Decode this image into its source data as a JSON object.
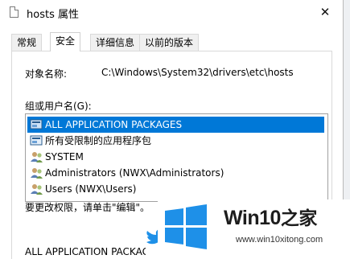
{
  "window": {
    "title": "hosts 属性",
    "close_glyph": "✕"
  },
  "tabs": [
    {
      "label": "常规",
      "active": false
    },
    {
      "label": "安全",
      "active": true
    },
    {
      "label": "详细信息",
      "active": false
    },
    {
      "label": "以前的版本",
      "active": false
    }
  ],
  "security": {
    "object_name_label": "对象名称:",
    "object_name_value": "C:\\Windows\\System32\\drivers\\etc\\hosts",
    "group_label": "组或用户名(G):",
    "principals": [
      {
        "label": "ALL APPLICATION PACKAGES",
        "icon": "package-group-icon",
        "selected": true
      },
      {
        "label": "所有受限制的应用程序包",
        "icon": "package-group-icon",
        "selected": false
      },
      {
        "label": "SYSTEM",
        "icon": "users-group-icon",
        "selected": false
      },
      {
        "label": "Administrators (NWX\\Administrators)",
        "icon": "users-group-icon",
        "selected": false
      },
      {
        "label": "Users (NWX\\Users)",
        "icon": "users-group-icon",
        "selected": false
      }
    ],
    "change_hint": "要更改权限，请单击\"编辑\"。",
    "permissions_header": "ALL APPLICATION PACKAGES"
  },
  "watermark": {
    "brand": "Win10",
    "brand_suffix": "之家",
    "site": "www.win10xitong.com"
  },
  "colors": {
    "selection": "#0078d7",
    "windows_logo": "#1e90e8"
  }
}
